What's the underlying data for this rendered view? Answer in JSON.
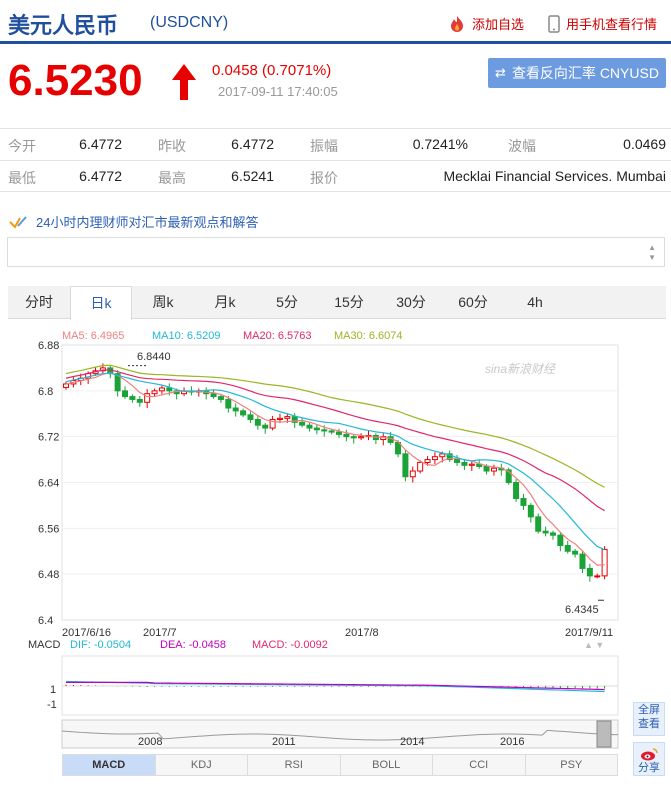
{
  "header": {
    "name": "美元人民币",
    "code": "(USDCNY)",
    "add_watch": "添加自选",
    "mobile_view": "用手机查看行情"
  },
  "quote": {
    "price": "6.5230",
    "change": "0.0458 (0.7071%)",
    "timestamp": "2017-09-11 17:40:05",
    "reverse_button": "查看反向汇率 CNYUSD"
  },
  "stats": {
    "rows": [
      [
        {
          "l": "今开",
          "v": "6.4772"
        },
        {
          "l": "昨收",
          "v": "6.4772"
        },
        {
          "l": "振幅",
          "v": "0.7241%"
        },
        {
          "l": "波幅",
          "v": "0.0469"
        }
      ],
      [
        {
          "l": "最低",
          "v": "6.4772"
        },
        {
          "l": "最高",
          "v": "6.5241"
        },
        {
          "l": "报价",
          "v": "Mecklai Financial Services. Mumbai"
        }
      ]
    ]
  },
  "news": {
    "text": "24小时内理财师对汇市最新观点和解答"
  },
  "tabs": [
    "分时",
    "日k",
    "周k",
    "月k",
    "5分",
    "15分",
    "30分",
    "60分",
    "4h"
  ],
  "active_tab": 1,
  "colors": {
    "up": "#e60000",
    "down": "#1aa336",
    "brand": "#1f4f9e",
    "ma5": "#f08080",
    "ma10": "#22b8d9",
    "ma20": "#e0286e",
    "ma30": "#9ab624"
  },
  "chart_data": {
    "type": "candlestick",
    "ma_legend": {
      "ma5": "MA5: 6.4965",
      "ma10": "MA10: 6.5209",
      "ma20": "MA20: 6.5763",
      "ma30": "MA30: 6.6074"
    },
    "y_ticks": [
      "6.88",
      "6.8",
      "6.72",
      "6.64",
      "6.56",
      "6.48",
      "6.4"
    ],
    "y_values": [
      6.88,
      6.8,
      6.72,
      6.64,
      6.56,
      6.48,
      6.4
    ],
    "x_labels": [
      "2017/6/16",
      "2017/7",
      "2017/8",
      "2017/9/11"
    ],
    "high_note": "6.8440",
    "low_note": "6.4345",
    "watermark": "sina新浪财经",
    "close": [
      6.812,
      6.818,
      6.822,
      6.83,
      6.835,
      6.84,
      6.83,
      6.8,
      6.79,
      6.785,
      6.78,
      6.795,
      6.8,
      6.805,
      6.8,
      6.795,
      6.8,
      6.798,
      6.8,
      6.795,
      6.79,
      6.785,
      6.77,
      6.765,
      6.758,
      6.75,
      6.74,
      6.735,
      6.75,
      6.752,
      6.755,
      6.745,
      6.74,
      6.735,
      6.732,
      6.73,
      6.728,
      6.724,
      6.72,
      6.718,
      6.72,
      6.722,
      6.715,
      6.72,
      6.71,
      6.69,
      6.65,
      6.66,
      6.675,
      6.68,
      6.685,
      6.69,
      6.68,
      6.675,
      6.67,
      6.672,
      6.668,
      6.66,
      6.665,
      6.662,
      6.64,
      6.612,
      6.6,
      6.58,
      6.555,
      6.552,
      6.548,
      6.53,
      6.52,
      6.515,
      6.49,
      6.477,
      6.477,
      6.523
    ],
    "macd": {
      "legend": {
        "label": "MACD",
        "dif": "DIF: -0.0504",
        "dea": "DEA: -0.0458",
        "macd": "MACD: -0.0092"
      },
      "y_ticks": [
        "1",
        "-1"
      ]
    },
    "overview_labels": [
      "2008",
      "2011",
      "2014",
      "2016"
    ]
  },
  "indicator_tabs": [
    "MACD",
    "KDJ",
    "RSI",
    "BOLL",
    "CCI",
    "PSY"
  ],
  "side_buttons": {
    "fullscreen": "全屏查看",
    "share": "分享"
  }
}
